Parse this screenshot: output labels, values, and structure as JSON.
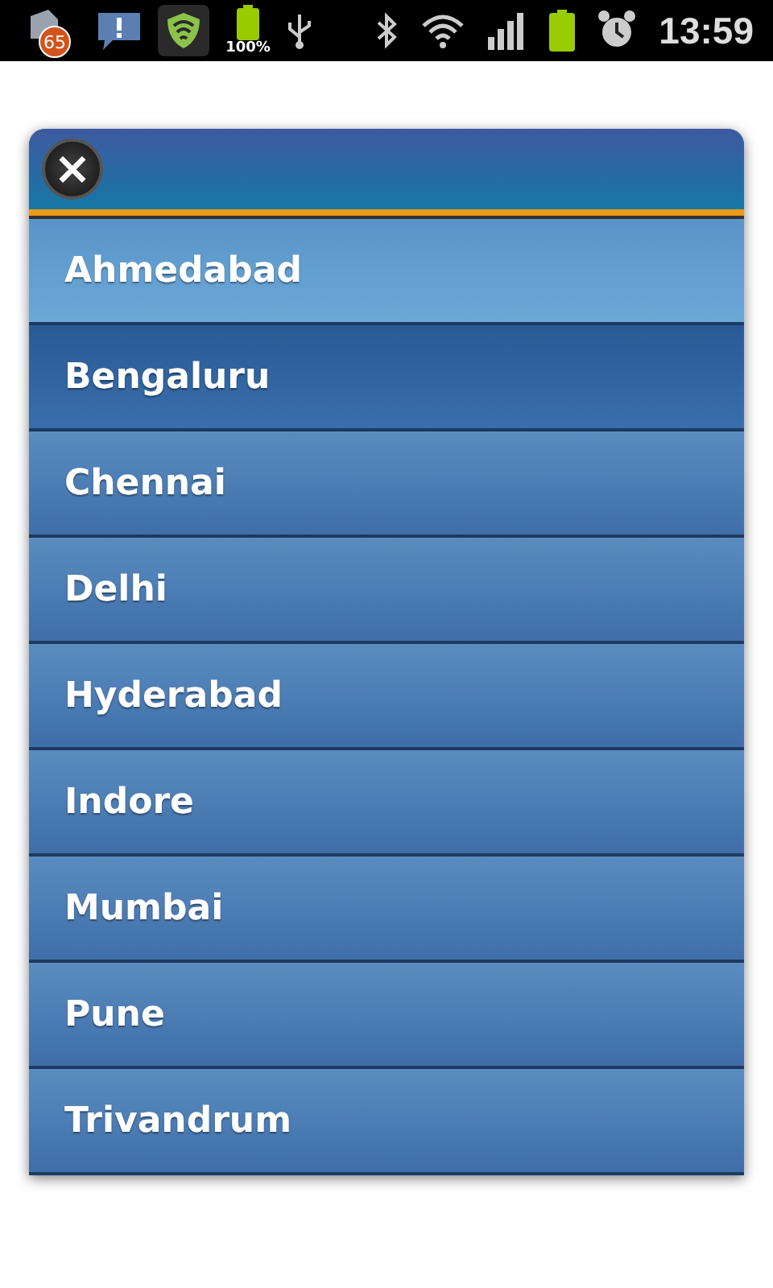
{
  "status_bar": {
    "notification_count": "65",
    "battery_app_label": "100%",
    "time": "13:59"
  },
  "dialog": {
    "close_icon": "×",
    "items": [
      {
        "label": "Ahmedabad",
        "selected": true,
        "pressed": false
      },
      {
        "label": "Bengaluru",
        "selected": false,
        "pressed": true
      },
      {
        "label": "Chennai",
        "selected": false,
        "pressed": false
      },
      {
        "label": "Delhi",
        "selected": false,
        "pressed": false
      },
      {
        "label": "Hyderabad",
        "selected": false,
        "pressed": false
      },
      {
        "label": "Indore",
        "selected": false,
        "pressed": false
      },
      {
        "label": "Mumbai",
        "selected": false,
        "pressed": false
      },
      {
        "label": "Pune",
        "selected": false,
        "pressed": false
      },
      {
        "label": "Trivandrum",
        "selected": false,
        "pressed": false
      }
    ]
  }
}
